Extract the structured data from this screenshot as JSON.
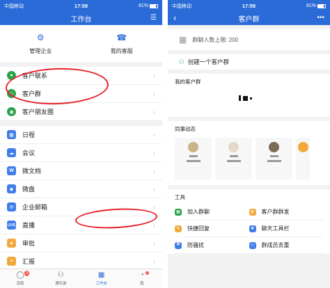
{
  "left": {
    "status": {
      "carrier": "中国移动",
      "time": "17:58",
      "battery": "81%"
    },
    "nav_title": "工作台",
    "tiles": [
      {
        "label": "管理企业",
        "icon": "sliders-icon"
      },
      {
        "label": "我的客服",
        "icon": "headset-icon"
      }
    ],
    "group1": [
      {
        "label": "客户联系",
        "icon": "chat-icon",
        "color": "#2aa24a"
      },
      {
        "label": "客户群",
        "icon": "group-icon",
        "color": "#2aa24a"
      },
      {
        "label": "客户朋友圈",
        "icon": "aperture-icon",
        "color": "#2aa24a"
      }
    ],
    "group2": [
      {
        "label": "日程",
        "icon": "calendar-icon",
        "color": "#3f7de8"
      },
      {
        "label": "会议",
        "icon": "cloud-icon",
        "color": "#3f7de8"
      },
      {
        "label": "微文档",
        "icon": "doc-icon",
        "color": "#3f7de8"
      },
      {
        "label": "微盘",
        "icon": "disk-icon",
        "color": "#3f7de8"
      },
      {
        "label": "企业邮箱",
        "icon": "mail-icon",
        "color": "#3f7de8"
      },
      {
        "label": "直播",
        "icon": "live-icon",
        "color": "#3f7de8"
      },
      {
        "label": "审批",
        "icon": "approve-icon",
        "color": "#f2a93b"
      },
      {
        "label": "汇报",
        "icon": "report-icon",
        "color": "#f2a93b"
      }
    ],
    "tabs": [
      {
        "label": "消息",
        "glyph": "◯",
        "badge": "3"
      },
      {
        "label": "通讯录",
        "glyph": "⚇"
      },
      {
        "label": "工作台",
        "glyph": "▦"
      },
      {
        "label": "我",
        "glyph": "◔"
      }
    ]
  },
  "right": {
    "status": {
      "carrier": "中国移动",
      "time": "17:58",
      "battery": "81%"
    },
    "nav_title": "客户群",
    "limit_text": "群聊人数上限: 200",
    "create_label": "创建一个客户群",
    "my_groups_title": "我的客户群",
    "moments_title": "同事动态",
    "tools_title": "工具",
    "tools": [
      {
        "label": "加入群聊",
        "icon": "qr-icon",
        "color": "#2aa24a"
      },
      {
        "label": "客户群群发",
        "icon": "broadcast-icon",
        "color": "#f2a93b"
      },
      {
        "label": "快捷回复",
        "icon": "quick-reply-icon",
        "color": "#f2a93b"
      },
      {
        "label": "聊天工具栏",
        "icon": "toolbar-icon",
        "color": "#3f7de8"
      },
      {
        "label": "防骚扰",
        "icon": "shield-icon",
        "color": "#3f7de8"
      },
      {
        "label": "群成员去重",
        "icon": "dedupe-icon",
        "color": "#3f7de8"
      }
    ]
  }
}
